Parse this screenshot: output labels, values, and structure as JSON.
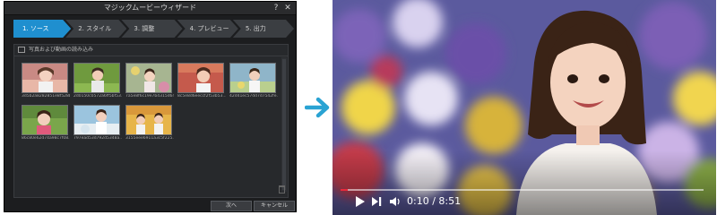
{
  "wizard": {
    "title": "マジックムービーウィザード",
    "help_icon": "?",
    "close_icon": "✕",
    "steps": [
      "1. ソース",
      "2. スタイル",
      "3. 調整",
      "4. プレビュー",
      "5. 出力"
    ],
    "active_step": 0,
    "import_label": "写真および動画の読み込み",
    "thumbnails": [
      {
        "caption": "3d5b2a8282851e8f528b..."
      },
      {
        "caption": "2d0150c0572a6ff5bf53..."
      },
      {
        "caption": "7a5e8f6c19e7b4315d64..."
      },
      {
        "caption": "8c5e8d6eeccf2f53b53..."
      },
      {
        "caption": "42d41ec57dd7d7542fe..."
      },
      {
        "caption": "86c80e62d74a98c7f08..."
      },
      {
        "caption": "797ead53d792d5348a..."
      },
      {
        "caption": "3155eee6911a3c5f225..."
      }
    ],
    "buttons": {
      "next": "次へ",
      "cancel": "キャンセル"
    },
    "colors": {
      "active_step": "#1f8fcf",
      "window_bg": "#1c1d1f"
    }
  },
  "arrow": {
    "color": "#2aa3d3"
  },
  "player": {
    "current_time": "0:10",
    "duration": "8:51",
    "time_text": "0:10 / 8:51",
    "progress": 0.02,
    "accent": "#e8293b",
    "icons": [
      "play-icon",
      "next-icon",
      "volume-icon"
    ]
  }
}
